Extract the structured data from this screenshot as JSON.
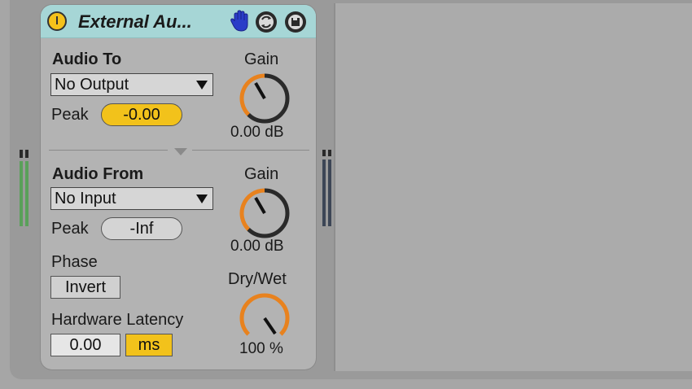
{
  "device": {
    "title": "External Au...",
    "icons": {
      "power": "power-icon",
      "hand": "hand-icon",
      "hotswap": "hotswap-icon",
      "save": "save-icon"
    }
  },
  "audio_to": {
    "label": "Audio To",
    "output_value": "No Output",
    "peak_label": "Peak",
    "peak_value": "-0.00",
    "gain_label": "Gain",
    "gain_value": "0.00 dB"
  },
  "audio_from": {
    "label": "Audio From",
    "input_value": "No Input",
    "peak_label": "Peak",
    "peak_value": "-Inf",
    "gain_label": "Gain",
    "gain_value": "0.00 dB"
  },
  "phase": {
    "label": "Phase",
    "invert_label": "Invert"
  },
  "latency": {
    "label": "Hardware Latency",
    "value": "0.00",
    "unit": "ms"
  },
  "drywet": {
    "label": "Dry/Wet",
    "value": "100 %"
  },
  "colors": {
    "title_bar": "#a6d6d6",
    "accent_yellow": "#f2c21b",
    "knob_orange": "#e8821e",
    "hand_blue": "#2a3cc8",
    "meter_green": "#5aa05a"
  }
}
